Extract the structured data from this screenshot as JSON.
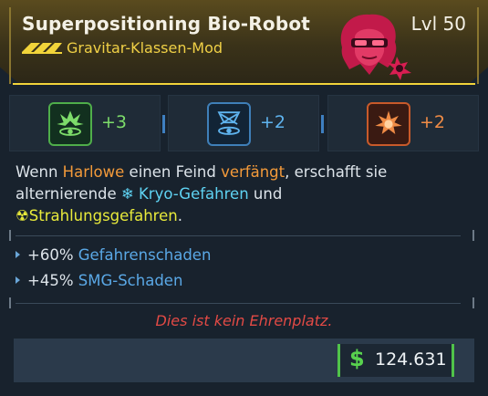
{
  "item": {
    "name": "Superpositioning Bio-Robot",
    "type": "Gravitar-Klassen-Mod",
    "level": "Lvl 50"
  },
  "skills": [
    {
      "icon": "green-skill-icon",
      "bonus": "+3",
      "color": "#7ddc6a"
    },
    {
      "icon": "blue-skill-icon",
      "bonus": "+2",
      "color": "#5fb4ef"
    },
    {
      "icon": "orange-skill-icon",
      "bonus": "+2",
      "color": "#f08c46"
    }
  ],
  "description": {
    "part1": "Wenn ",
    "character": "Harlowe",
    "part2": " einen Feind ",
    "verb": "verfängt",
    "part3": ", erschafft sie alternierende ",
    "cryo": "Kryo-Gefahren",
    "part4": " und",
    "radiation": "Strahlungsgefahren",
    "part5": "."
  },
  "stats": [
    {
      "value": "+60%",
      "name": "Gefahrenschaden"
    },
    {
      "value": "+45%",
      "name": "SMG-Schaden"
    }
  ],
  "flavor_text": "Dies ist kein Ehrenplatz.",
  "price": {
    "currency_symbol": "$",
    "value": "124.631"
  },
  "colors": {
    "rarity": "#f2d43a",
    "money": "#58d24e",
    "flavor": "#e24a45"
  }
}
